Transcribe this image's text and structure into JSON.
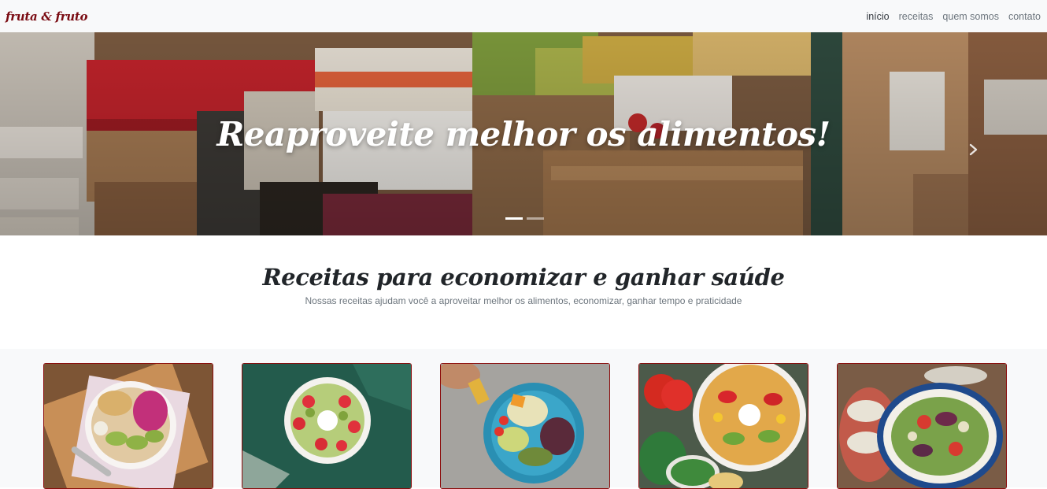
{
  "navbar": {
    "brand": "fruta & fruto",
    "links": [
      {
        "label": "início",
        "active": true
      },
      {
        "label": "receitas",
        "active": false
      },
      {
        "label": "quem somos",
        "active": false
      },
      {
        "label": "contato",
        "active": false
      }
    ]
  },
  "hero": {
    "title": "Reaproveite melhor os alimentos!",
    "slide_count": 2,
    "active_slide": 1
  },
  "intro": {
    "title": "Receitas para economizar e ganhar saúde",
    "subtitle": "Nossas receitas ajudam você a aproveitar melhor os alimentos, economizar, ganhar tempo e praticidade"
  },
  "icons": {
    "carousel_next": "chevron-right-icon"
  },
  "colors": {
    "brand": "#7a0b12",
    "card_border": "#8b0a0a",
    "navbar_bg": "#f8f9fa"
  }
}
